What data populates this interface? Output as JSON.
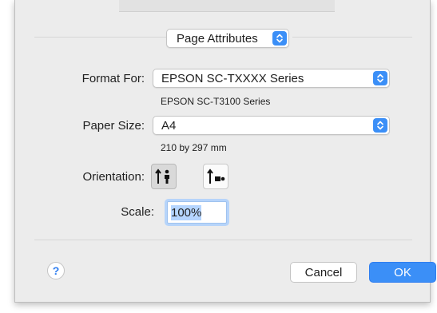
{
  "dialog": {
    "settings_menu": {
      "selected": "Page Attributes"
    },
    "format_for": {
      "label": "Format For:",
      "value": "EPSON SC-TXXXX Series",
      "detail": "EPSON SC-T3100 Series"
    },
    "paper_size": {
      "label": "Paper Size:",
      "value": "A4",
      "detail": "210 by 297 mm"
    },
    "orientation": {
      "label": "Orientation:",
      "options": [
        "portrait",
        "landscape"
      ],
      "selected": "portrait"
    },
    "scale": {
      "label": "Scale:",
      "value": "100%"
    },
    "help": {
      "glyph": "?"
    },
    "buttons": {
      "cancel": "Cancel",
      "ok": "OK"
    }
  },
  "colors": {
    "accent": "#3b8ff7",
    "dialog_bg": "#ececec",
    "selection": "#b5d5ff"
  }
}
